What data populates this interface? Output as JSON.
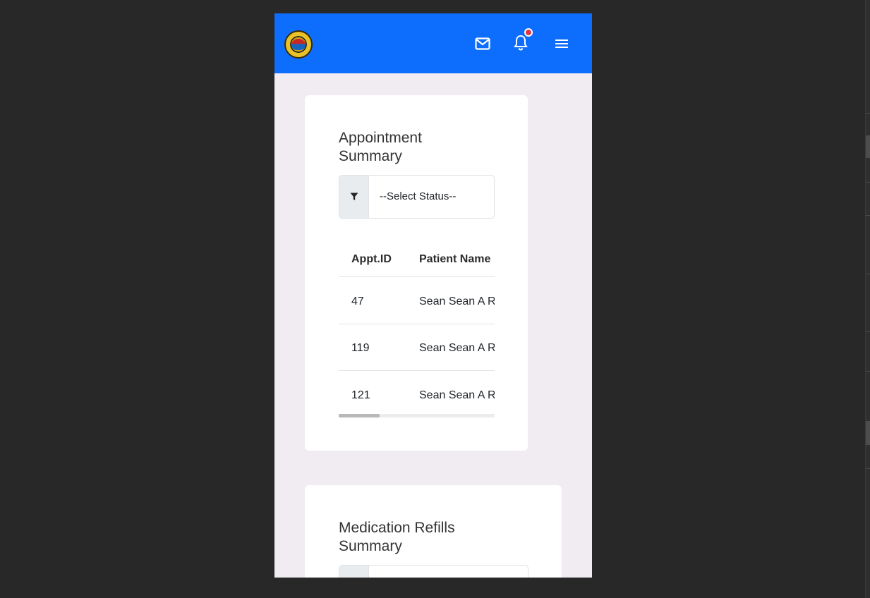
{
  "header": {
    "logo_icon": "municipal-seal-logo",
    "brand_color": "#0d6efd",
    "notification_badge_color": "#dc3545",
    "icons": [
      "mail-icon",
      "bell-icon",
      "hamburger-menu-icon"
    ]
  },
  "appointment_summary": {
    "title": "Appointment Summary",
    "filter_icon": "funnel-icon",
    "status_select": "--Select Status--",
    "columns": [
      "Appt.ID",
      "Patient Name"
    ],
    "rows": [
      {
        "id": "47",
        "patient": "Sean Sean A R"
      },
      {
        "id": "119",
        "patient": "Sean Sean A R"
      },
      {
        "id": "121",
        "patient": "Sean Sean A R"
      }
    ]
  },
  "medication_refills_summary": {
    "title": "Medication Refills Summary"
  }
}
